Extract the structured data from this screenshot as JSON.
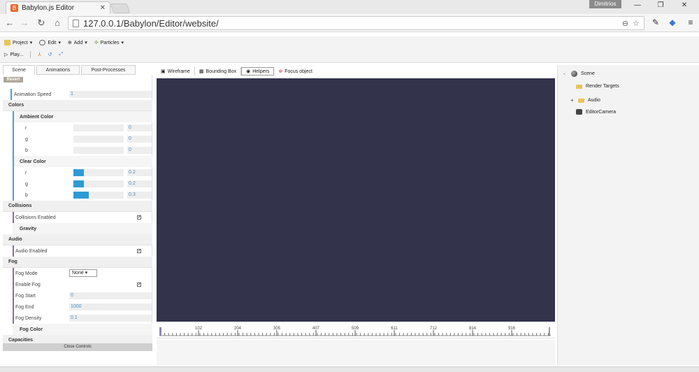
{
  "browser": {
    "tab_title": "Babylon.js Editor",
    "user_name": "Dimitrios",
    "url": "127.0.0.1/Babylon/Editor/website/"
  },
  "toolbar": {
    "project": "Project",
    "edit": "Edit",
    "add": "Add",
    "particles": "Particles",
    "play": "Play..."
  },
  "left_tabs": [
    "Scene",
    "Animations",
    "Post-Processes"
  ],
  "left": {
    "revert": "Revert",
    "animation_speed_label": "Animation Speed",
    "animation_speed_value": "1",
    "colors": "Colors",
    "ambient_color": "Ambient Color",
    "ambient": [
      {
        "label": "r",
        "value": "0",
        "fraction": 0
      },
      {
        "label": "g",
        "value": "0",
        "fraction": 0
      },
      {
        "label": "b",
        "value": "0",
        "fraction": 0
      }
    ],
    "clear_color": "Clear Color",
    "clear": [
      {
        "label": "r",
        "value": "0.2",
        "fraction": 0.2
      },
      {
        "label": "g",
        "value": "0.2",
        "fraction": 0.2
      },
      {
        "label": "b",
        "value": "0.3",
        "fraction": 0.3
      }
    ],
    "collisions": "Collisions",
    "collisions_enabled": "Collisions Enabled",
    "gravity": "Gravity",
    "audio": "Audio",
    "audio_enabled": "Audio Enabled",
    "fog": "Fog",
    "fog_mode_label": "Fog Mode",
    "fog_mode_value": "None",
    "enable_fog": "Enable Fog",
    "fog_start_label": "Fog Start",
    "fog_start_value": "0",
    "fog_end_label": "Fog End",
    "fog_end_value": "1000",
    "fog_density_label": "Fog Density",
    "fog_density_value": "0.1",
    "fog_color": "Fog Color",
    "capacities": "Capacities",
    "close_controls": "Close Controls"
  },
  "view_tabs": [
    "Wireframe",
    "Bounding Box",
    "Helpers",
    "Focus object"
  ],
  "timeline": {
    "ticks": [
      "102",
      "204",
      "305",
      "407",
      "509",
      "611",
      "712",
      "814",
      "916"
    ]
  },
  "tree": {
    "scene": "Scene",
    "render_targets": "Render Targets",
    "audio": "Audio",
    "editor_camera": "EditorCamera"
  },
  "colors": {
    "viewport": "#33334b",
    "accent": "#2e9bd6"
  }
}
